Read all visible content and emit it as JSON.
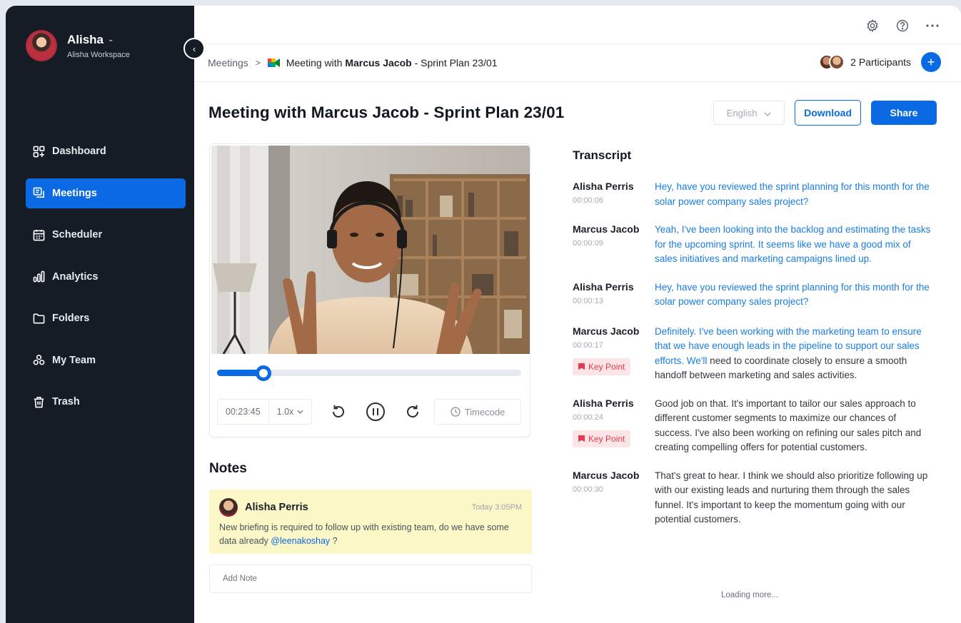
{
  "sidebar": {
    "user_name": "Alisha",
    "workspace": "Alisha Workspace",
    "items": [
      {
        "label": "Dashboard",
        "icon": "dashboard-icon"
      },
      {
        "label": "Meetings",
        "icon": "meetings-icon",
        "active": true
      },
      {
        "label": "Scheduler",
        "icon": "calendar-icon"
      },
      {
        "label": "Analytics",
        "icon": "analytics-icon"
      },
      {
        "label": "Folders",
        "icon": "folder-icon"
      },
      {
        "label": "My Team",
        "icon": "team-icon"
      },
      {
        "label": "Trash",
        "icon": "trash-icon"
      }
    ]
  },
  "breadcrumb": {
    "root": "Meetings",
    "current_prefix": "Meeting with",
    "current_bold": "Marcus Jacob",
    "current_suffix": "- Sprint Plan 23/01"
  },
  "participants": {
    "label": "2 Participants"
  },
  "header": {
    "title": "Meeting with Marcus Jacob - Sprint Plan 23/01",
    "language": "English",
    "download_label": "Download",
    "share_label": "Share"
  },
  "player": {
    "current_time": "00:23:45",
    "speed": "1.0x",
    "timecode_label": "Timecode",
    "progress": 0.13
  },
  "notes": {
    "title": "Notes",
    "items": [
      {
        "author": "Alisha Perris",
        "time": "Today 3:05PM",
        "text": "New briefing is required to follow up with existing team, do we have some data already",
        "mention": "@leenakoshay",
        "suffix": " ?"
      }
    ],
    "add_placeholder": "Add Note"
  },
  "transcript": {
    "title": "Transcript",
    "keypoint_label": "Key Point",
    "entries": [
      {
        "speaker": "Alisha Perris",
        "time": "00:00:06",
        "highlight": "Hey, have you reviewed the sprint planning for this month for the solar power company sales project?",
        "rest": ""
      },
      {
        "speaker": "Marcus Jacob",
        "time": "00:00:09",
        "highlight": "Yeah, I've been looking into the backlog and estimating the tasks for the upcoming sprint. It seems like we have a good mix of sales initiatives and marketing campaigns lined up.",
        "rest": ""
      },
      {
        "speaker": "Alisha Perris",
        "time": "00:00:13",
        "highlight": "Hey, have you reviewed the sprint planning for this month for the solar power company sales project?",
        "rest": ""
      },
      {
        "speaker": "Marcus Jacob",
        "time": "00:00:17",
        "keypoint": true,
        "highlight": "Definitely. I've been working with the marketing team to ensure that we have enough leads in the pipeline to support our sales efforts. We'll",
        "rest": " need to coordinate closely to ensure a smooth handoff between marketing and sales activities."
      },
      {
        "speaker": "Alisha Perris",
        "time": "00:00:24",
        "keypoint": true,
        "highlight": "",
        "rest": "Good job on that. It's important to tailor our sales approach to different customer segments to maximize our chances of success. I've also been working on refining our sales pitch and creating compelling offers for potential customers."
      },
      {
        "speaker": "Marcus Jacob",
        "time": "00:00:30",
        "highlight": "",
        "rest": "That's great to hear. I think we should also prioritize following up with our existing leads and nurturing them through the sales funnel. It's important to keep the momentum going with our potential customers."
      }
    ],
    "loading_label": "Loading more..."
  }
}
